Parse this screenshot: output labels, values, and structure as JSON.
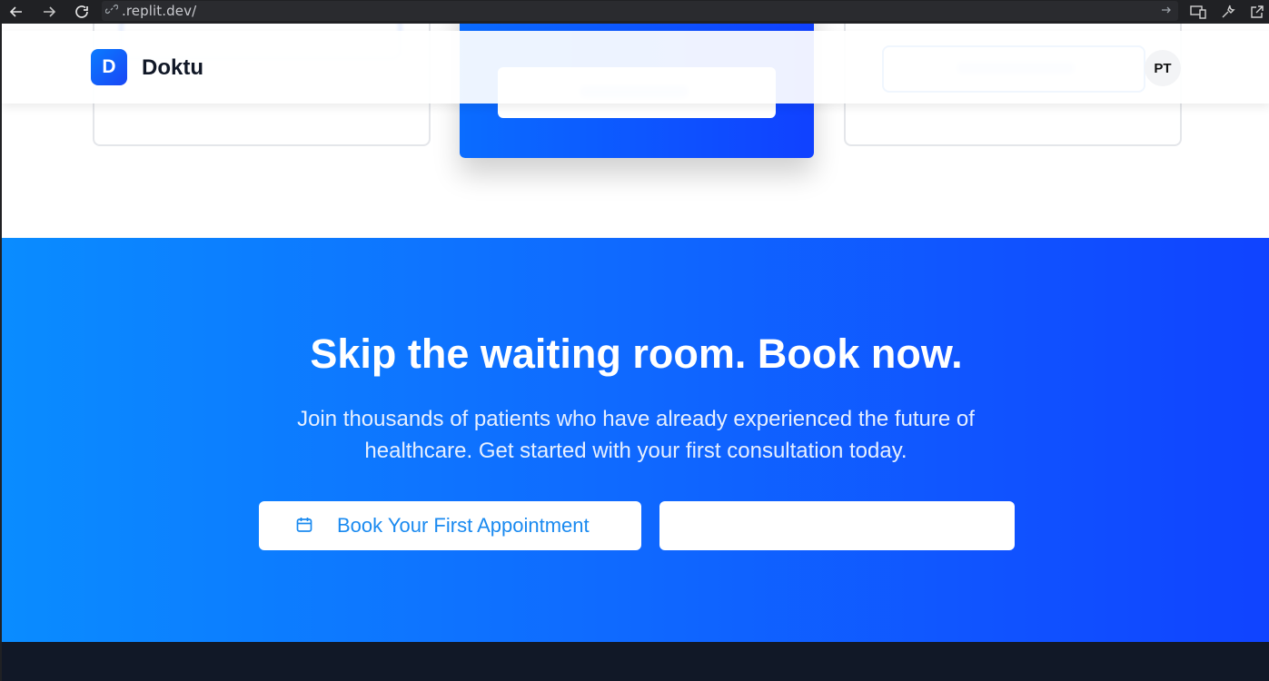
{
  "browser": {
    "url": ".replit.dev/"
  },
  "header": {
    "logo_letter": "D",
    "brand": "Doktu",
    "avatar_initials": "PT"
  },
  "cta": {
    "title": "Skip the waiting room. Book now.",
    "subtitle": "Join thousands of patients who have already experienced the future of healthcare. Get started with your first consultation today.",
    "primary_button": "Book Your First Appointment",
    "secondary_button": ""
  },
  "colors": {
    "accent": "#1a8af0",
    "gradient_start": "#0a8cff",
    "gradient_end": "#1043ff",
    "footer": "#111827"
  },
  "icons": [
    "back-arrow-icon",
    "forward-arrow-icon",
    "reload-icon",
    "link-icon",
    "go-arrow-icon",
    "device-icon",
    "wrench-icon",
    "open-external-icon",
    "calendar-icon"
  ]
}
